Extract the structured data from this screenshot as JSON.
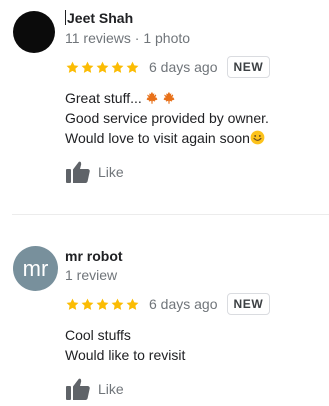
{
  "reviews": [
    {
      "name": "Jeet Shah",
      "meta": "11 reviews · 1 photo",
      "rating": 5,
      "date": "6 days ago",
      "badge": "NEW",
      "line1": "Great stuff...",
      "line2": "Good service provided by owner.",
      "line3": "Would love to visit again soon",
      "like_label": "Like"
    },
    {
      "name": "mr robot",
      "avatar_text": "mr",
      "meta": "1 review",
      "rating": 5,
      "date": "6 days ago",
      "badge": "NEW",
      "line1": "Cool stuffs",
      "line2": "Would like to revisit",
      "like_label": "Like"
    }
  ],
  "colors": {
    "star": "#fbbc04",
    "secondary_text": "#70757a",
    "thumb": "#5f6368",
    "avatar2_bg": "#78909c"
  },
  "icons": {
    "star": "star-icon",
    "like": "thumbs-up-icon",
    "leaf": "maple-leaf-icon",
    "smiley": "smiley-emoji-icon"
  }
}
